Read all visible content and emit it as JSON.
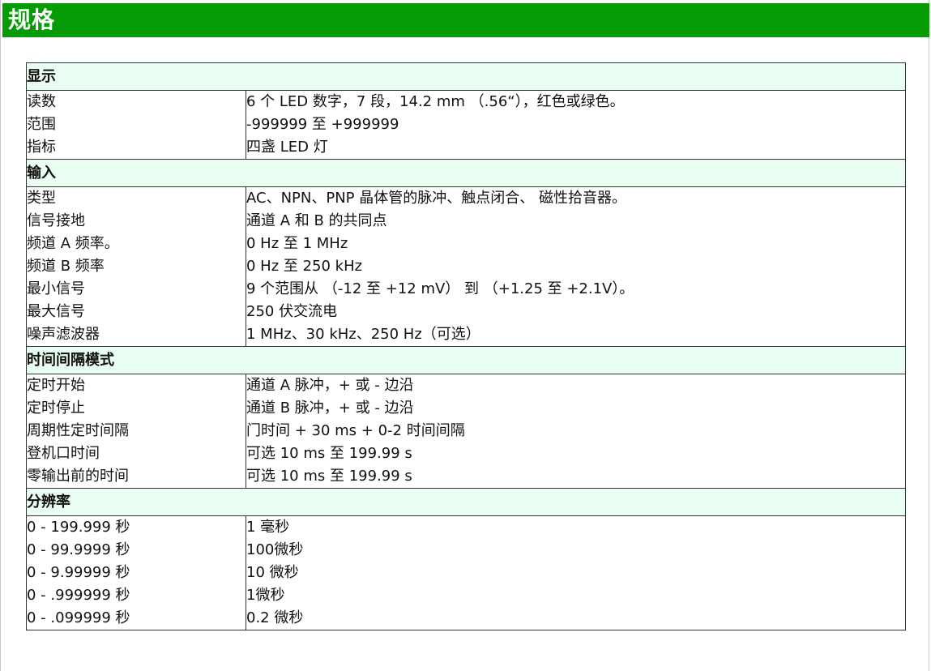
{
  "page": {
    "title": "规格"
  },
  "sections": [
    {
      "title": "显示",
      "rows": [
        {
          "label": "读数",
          "value": "6 个 LED 数字，7 段，14.2 mm （.56“），红色或绿色。"
        },
        {
          "label": "范围",
          "value": "-999999 至 +999999"
        },
        {
          "label": "指标",
          "value": "四盏 LED 灯"
        }
      ]
    },
    {
      "title": "输入",
      "rows": [
        {
          "label": "类型",
          "value": "AC、NPN、PNP 晶体管的脉冲、触点闭合、 磁性拾音器。"
        },
        {
          "label": "信号接地",
          "value": "通道 A 和 B 的共同点"
        },
        {
          "label": "频道 A 频率。",
          "value": "0 Hz 至 1 MHz"
        },
        {
          "label": "频道 B 频率",
          "value": "0 Hz 至 250 kHz"
        },
        {
          "label": "最小信号",
          "value": "9 个范围从 （-12 至 +12 mV） 到 （+1.25 至 +2.1V）。"
        },
        {
          "label": "最大信号",
          "value": "250 伏交流电"
        },
        {
          "label": "噪声滤波器",
          "value": "1 MHz、30 kHz、250 Hz（可选）"
        }
      ]
    },
    {
      "title": "时间间隔模式",
      "rows": [
        {
          "label": "定时开始",
          "value": "通道 A 脉冲，+ 或 - 边沿"
        },
        {
          "label": "定时停止",
          "value": "通道 B 脉冲，+ 或 - 边沿"
        },
        {
          "label": "周期性定时间隔",
          "value": "门时间 + 30 ms + 0-2 时间间隔"
        },
        {
          "label": "登机口时间",
          "value": "可选 10 ms 至 199.99 s"
        },
        {
          "label": "零输出前的时间",
          "value": "可选 10 ms 至 199.99 s"
        }
      ]
    },
    {
      "title": "分辨率",
      "rows": [
        {
          "label": "0 - 199.999 秒",
          "value": "1 毫秒"
        },
        {
          "label": "0 - 99.9999 秒",
          "value": "100微秒"
        },
        {
          "label": "0 - 9.99999 秒",
          "value": "10 微秒"
        },
        {
          "label": "0 - .999999 秒",
          "value": "1微秒"
        },
        {
          "label": "0 - .099999 秒",
          "value": "0.2 微秒"
        }
      ]
    }
  ]
}
